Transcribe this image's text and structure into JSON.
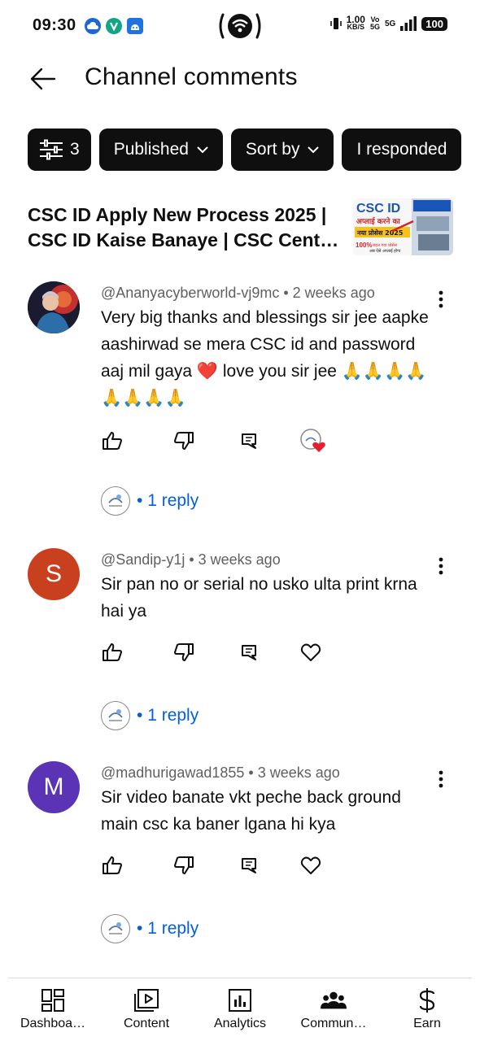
{
  "status_bar": {
    "time": "09:30",
    "net_speed_value": "1.00",
    "net_speed_unit": "KB/S",
    "battery": "100",
    "network": "5G"
  },
  "header": {
    "title": "Channel comments"
  },
  "filters": {
    "filter_count": "3",
    "chips": [
      "Published",
      "Sort by",
      "I responded"
    ]
  },
  "video": {
    "title": "CSC ID Apply New Process 2025 | CSC ID Kaise Banaye | CSC Cent…",
    "thumbnail_text": {
      "line1": "CSC ID",
      "line2": "अप्लाई करने का",
      "line3": "नया प्रोसेस 2025",
      "line4": "100%",
      "line5": "बदल गया प्रोसेस",
      "line6": "अब ऐसे अप्लाई होगा"
    }
  },
  "comments": [
    {
      "author": "@Ananyacyberworld-vj9mc",
      "age": "2 weeks ago",
      "text": "Very big thanks and blessings sir jee aapke aashirwad se mera CSC id and password aaj mil gaya ❤️ love you sir jee 🙏🙏🙏🙏🙏🙏🙏🙏",
      "avatar_color": "#1b1b2f",
      "hearted": true,
      "replies": "1 reply"
    },
    {
      "author": "@Sandip-y1j",
      "age": "3 weeks ago",
      "text": "Sir pan no or serial no  usko ulta print krna hai ya",
      "avatar_letter": "S",
      "avatar_color": "#c9401f",
      "hearted": false,
      "replies": "1 reply"
    },
    {
      "author": "@madhurigawad1855",
      "age": "3 weeks ago",
      "text": "Sir video banate vkt peche back ground main csc ka baner lgana hi kya",
      "avatar_letter": "M",
      "avatar_color": "#5b34b5",
      "hearted": false,
      "replies": "1 reply"
    }
  ],
  "bottom_nav": {
    "items": [
      "Dashboa…",
      "Content",
      "Analytics",
      "Commun…",
      "Earn"
    ]
  },
  "colors": {
    "link_blue": "#065fd4",
    "chip_bg": "#0f0f0f",
    "meta_gray": "#606060",
    "heart_red": "#e3202f"
  }
}
